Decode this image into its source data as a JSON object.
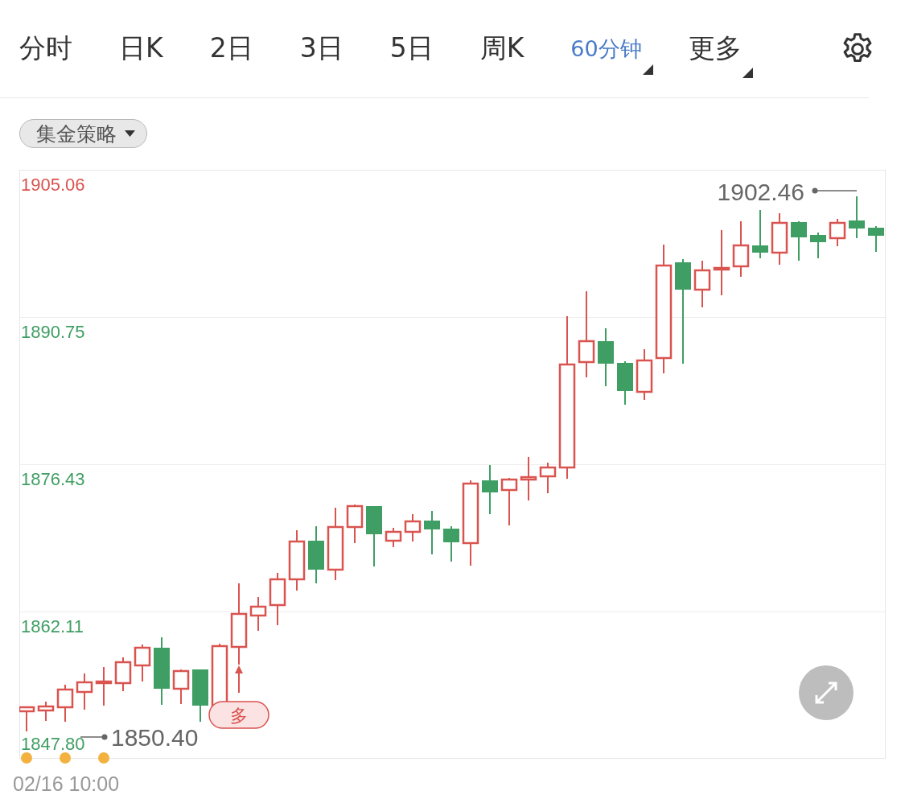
{
  "tabs": [
    {
      "label": "分时",
      "selected": false,
      "dropdown": false
    },
    {
      "label": "日K",
      "selected": false,
      "dropdown": false
    },
    {
      "label": "2日",
      "selected": false,
      "dropdown": false
    },
    {
      "label": "3日",
      "selected": false,
      "dropdown": false
    },
    {
      "label": "5日",
      "selected": false,
      "dropdown": false
    },
    {
      "label": "周K",
      "selected": false,
      "dropdown": false
    },
    {
      "label": "60分钟",
      "selected": true,
      "dropdown": true
    },
    {
      "label": "更多",
      "selected": false,
      "dropdown": true
    }
  ],
  "strategy_chip": {
    "label": "集金策略"
  },
  "chart": {
    "y_labels": [
      {
        "text": "1905.06",
        "color": "#d9534f"
      },
      {
        "text": "1890.75",
        "color": "#3f9e63"
      },
      {
        "text": "1876.43",
        "color": "#3f9e63"
      },
      {
        "text": "1862.11",
        "color": "#3f9e63"
      },
      {
        "text": "1847.80",
        "color": "#3f9e63"
      }
    ],
    "high_marker": "1902.46",
    "low_marker": "1850.40",
    "signal_tag": "多",
    "x_label": "02/16 10:00"
  }
}
